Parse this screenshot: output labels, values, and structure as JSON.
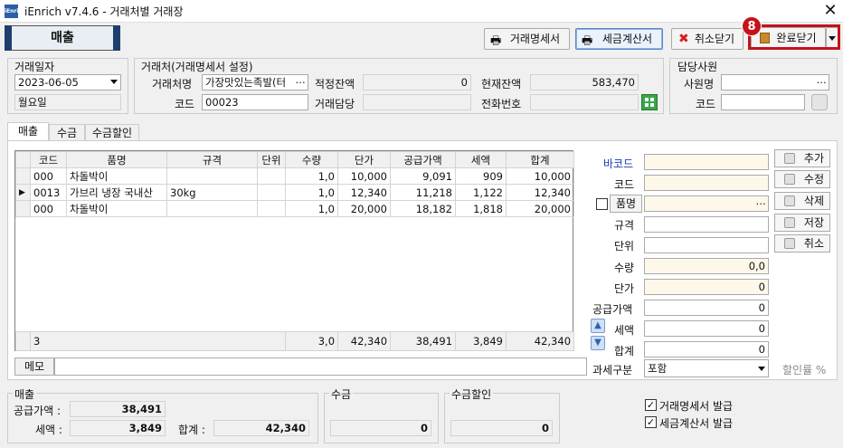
{
  "window": {
    "app_icon": "iEnrich",
    "title": "iEnrich v7.4.6 - 거래처별 거래장"
  },
  "mode_label": "매출",
  "toolbar": {
    "statement_label": "거래명세서",
    "tax_invoice_label": "세금계산서",
    "cancel_close_label": "취소닫기",
    "complete_close_label": "완료닫기",
    "step_badge": "8"
  },
  "trade_date": {
    "title": "거래일자",
    "date": "2023-06-05",
    "weekday": "월요일"
  },
  "partner": {
    "title": "거래처(거래명세서 설정)",
    "name_label": "거래처명",
    "name_value": "가장맛있는족발(터",
    "code_label": "코드",
    "code_value": "00023",
    "proper_balance_label": "적정잔액",
    "proper_balance_value": "0",
    "current_balance_label": "현재잔액",
    "current_balance_value": "583,470",
    "contact_label": "거래담당",
    "contact_value": "",
    "phone_label": "전화번호",
    "phone_value": ""
  },
  "staff": {
    "title": "담당사원",
    "name_label": "사원명",
    "code_label": "코드"
  },
  "tabs": [
    "매출",
    "수금",
    "수금할인"
  ],
  "grid": {
    "columns": [
      "코드",
      "품명",
      "규격",
      "단위",
      "수량",
      "단가",
      "공급가액",
      "세액",
      "합계"
    ],
    "rows": [
      {
        "marker": "",
        "code": "000",
        "name": "차돌박이",
        "spec": "",
        "unit": "",
        "qty": "1,0",
        "price": "10,000",
        "supply": "9,091",
        "tax": "909",
        "total": "10,000"
      },
      {
        "marker": "▶",
        "code": "0013",
        "name": "가브리 냉장 국내산",
        "spec": "30kg",
        "unit": "",
        "qty": "1,0",
        "price": "12,340",
        "supply": "11,218",
        "tax": "1,122",
        "total": "12,340"
      },
      {
        "marker": "",
        "code": "000",
        "name": "차돌박이",
        "spec": "",
        "unit": "",
        "qty": "1,0",
        "price": "20,000",
        "supply": "18,182",
        "tax": "1,818",
        "total": "20,000"
      }
    ],
    "footer": {
      "count": "3",
      "qty": "3,0",
      "price": "42,340",
      "supply": "38,491",
      "tax": "3,849",
      "total": "42,340"
    }
  },
  "memo_label": "메모",
  "form": {
    "barcode_label": "바코드",
    "code_label": "코드",
    "item_button": "품명",
    "spec_label": "규격",
    "unit_label": "단위",
    "qty_label": "수량",
    "qty_value": "0,0",
    "price_label": "단가",
    "price_value": "0",
    "supply_label": "공급가액",
    "supply_value": "0",
    "tax_label": "세액",
    "tax_value": "0",
    "total_label": "합계",
    "total_value": "0",
    "tax_type_label": "과세구분",
    "tax_type_value": "포함",
    "discount_rate_label": "할인률 %"
  },
  "side_buttons": [
    "추가",
    "수정",
    "삭제",
    "저장",
    "취소"
  ],
  "summary": {
    "sales_title": "매출",
    "supply_label": "공급가액 :",
    "supply_value": "38,491",
    "tax_label": "세액 :",
    "tax_value": "3,849",
    "total_label": "합계 :",
    "total_value": "42,340",
    "collection_title": "수금",
    "collection_value": "0",
    "collection_discount_title": "수금할인",
    "collection_discount_value": "0"
  },
  "issue": {
    "statement_label": "거래명세서 발급",
    "tax_invoice_label": "세금계산서 발급"
  }
}
